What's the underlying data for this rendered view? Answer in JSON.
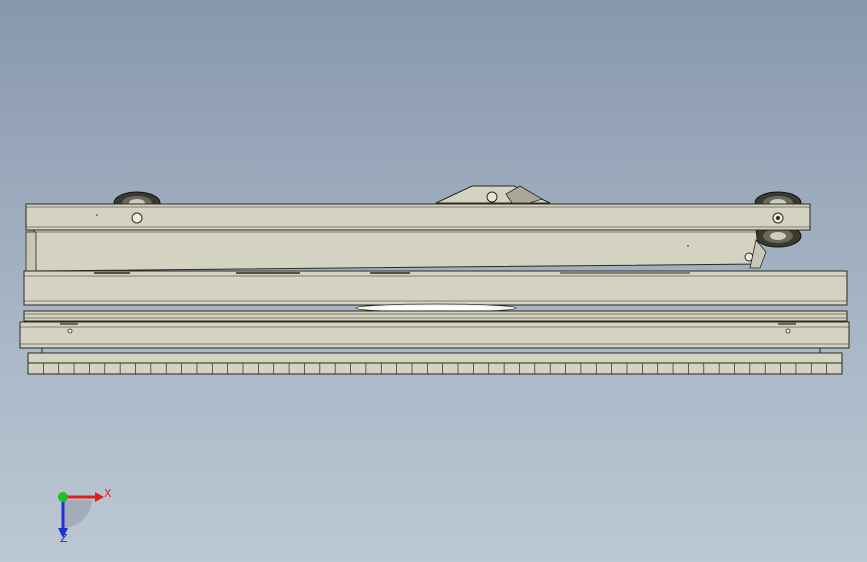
{
  "viewport": {
    "background_top": "#8898ab",
    "background_bottom": "#bcc8d4"
  },
  "model": {
    "part_color": "#d4d2c0",
    "part_shadow": "#b9b7a4",
    "edge_color": "#2a2a22",
    "ruler_tick_count": 53
  },
  "triad": {
    "x_label": "X",
    "z_label": "Z",
    "x_color": "#e02020",
    "y_color": "#20c020",
    "z_color": "#2030d0"
  }
}
